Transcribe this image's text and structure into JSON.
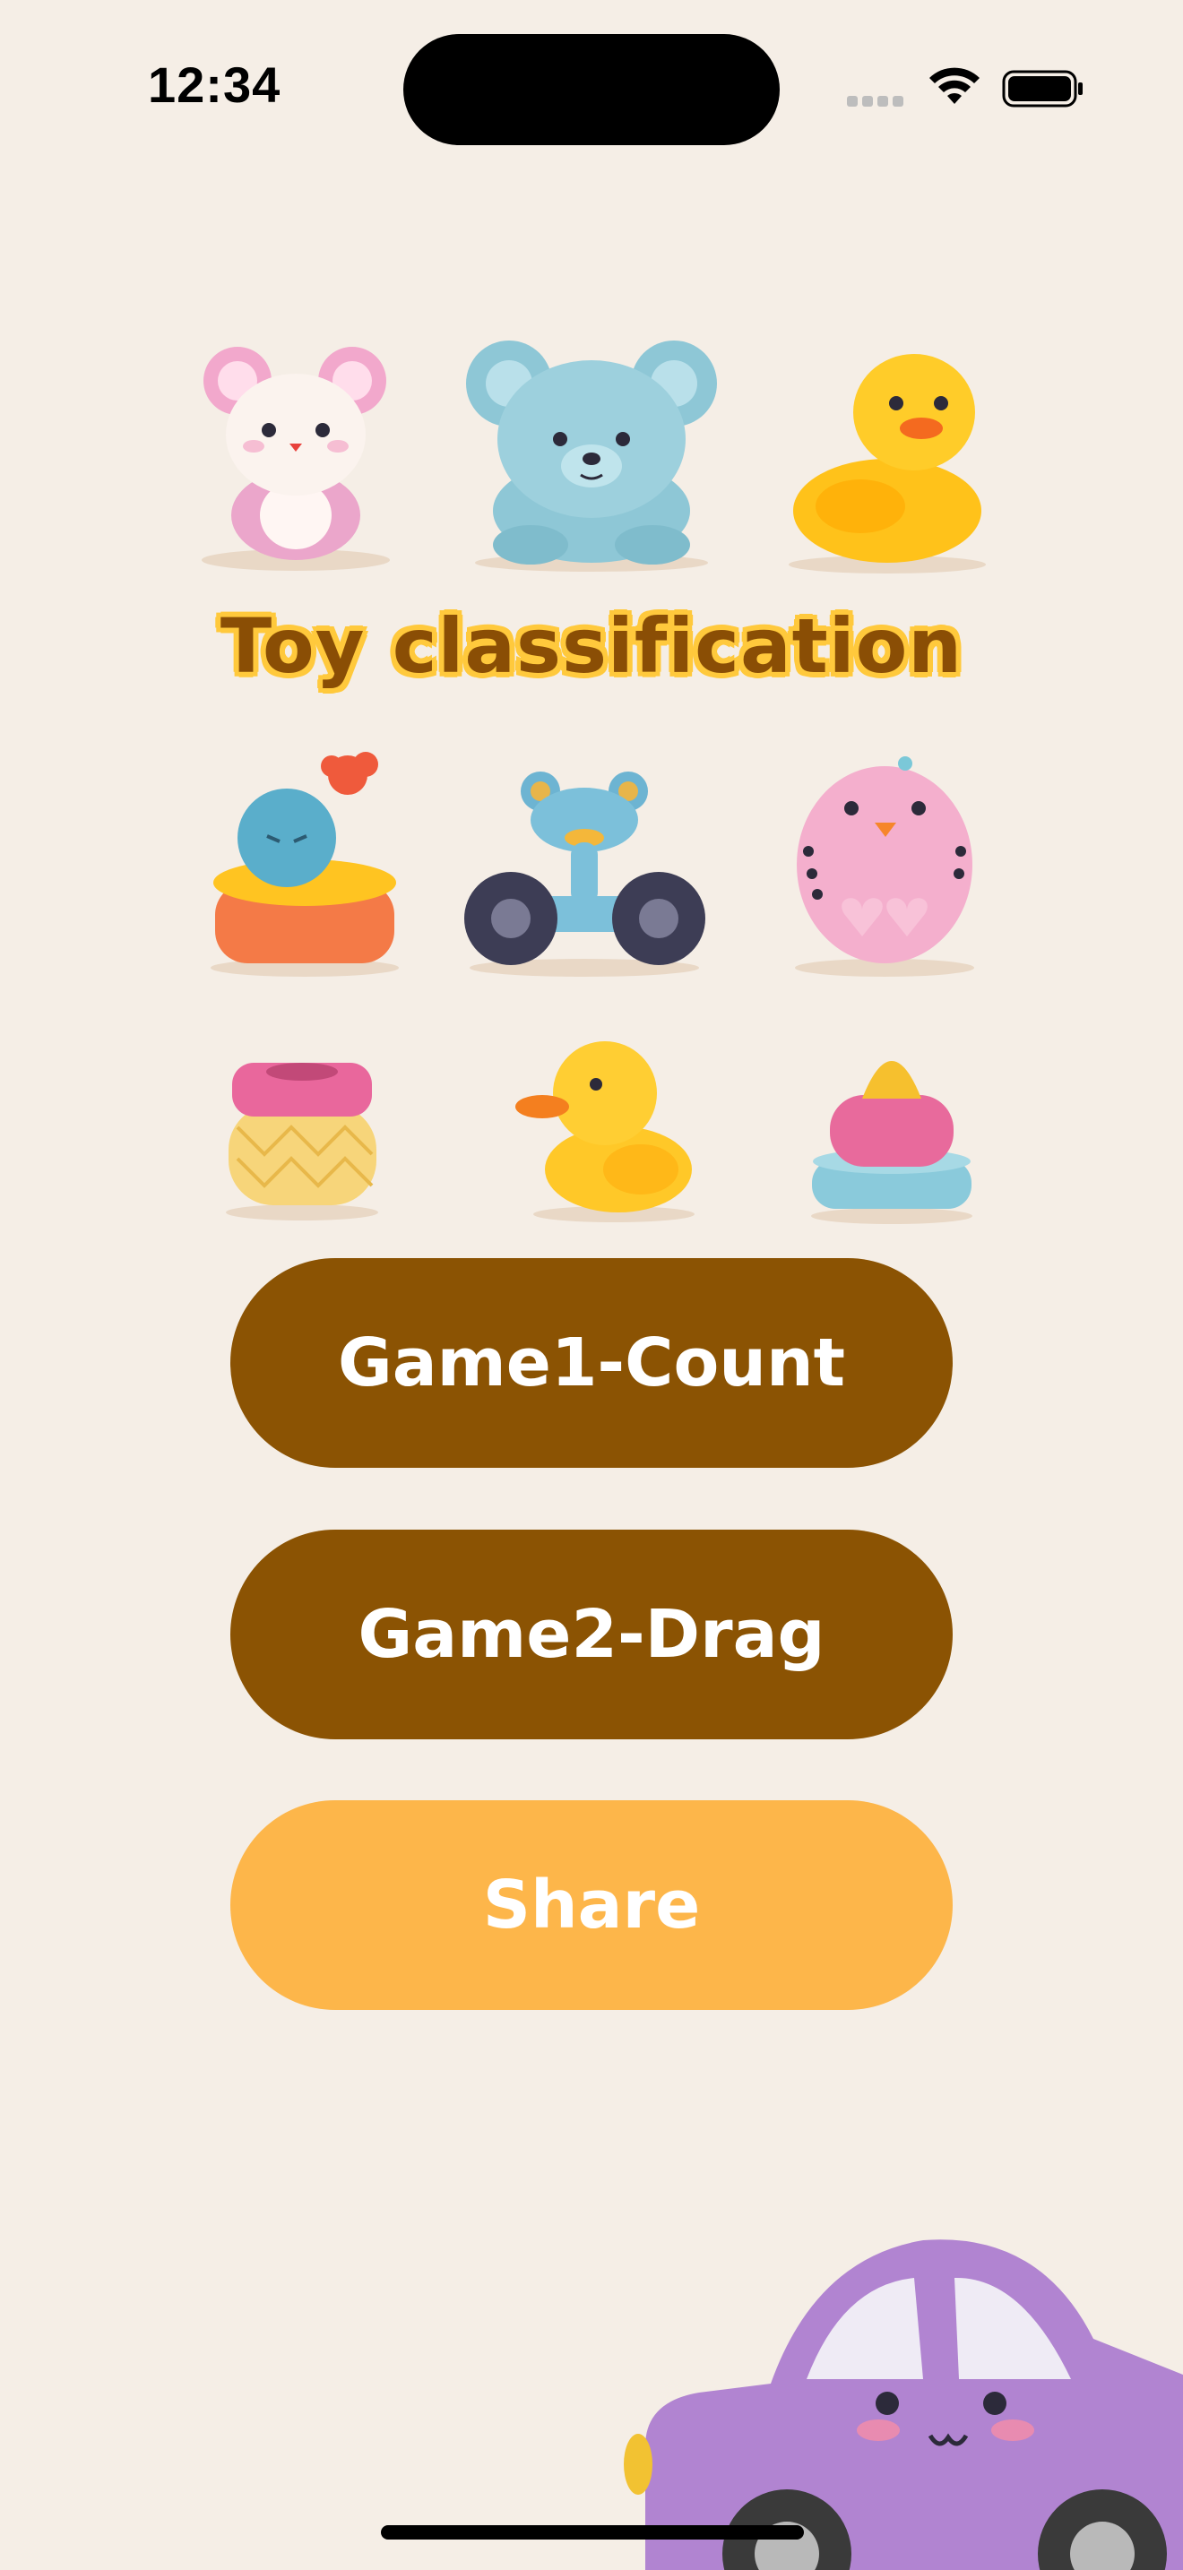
{
  "status_bar": {
    "time": "12:34"
  },
  "title": "Toy classification",
  "buttons": {
    "game1": "Game1-Count",
    "game2": "Game2-Drag",
    "share": "Share"
  },
  "colors": {
    "background": "#F5EEE6",
    "primary_button": "#8B5303",
    "share_button": "#FDB64A",
    "title_text": "#8A4E05",
    "title_outline": "#FFC93C"
  },
  "icons": [
    "mouse-toy-icon",
    "bear-toy-icon",
    "duck-toy-icon",
    "bird-stacker-toy-icon",
    "frog-bike-toy-icon",
    "pink-bird-toy-icon",
    "pineapple-cup-toy-icon",
    "duckling-toy-icon",
    "stacking-cone-toy-icon",
    "purple-car-toy-icon"
  ]
}
